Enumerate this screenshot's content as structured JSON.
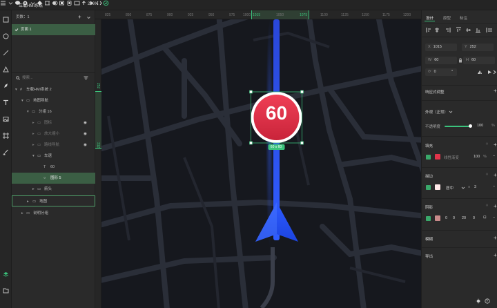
{
  "topbar": {
    "app_name": "车载HMI系统",
    "zoom": "246%"
  },
  "layers": {
    "pages_label": "页数：1",
    "page_item": "页面 1",
    "search_placeholder": "搜索...",
    "tree": [
      {
        "label": "车载HMI系统 2"
      },
      {
        "label": "地图导航"
      },
      {
        "label": "分组 16"
      },
      {
        "label": "图标"
      },
      {
        "label": "放大缩小"
      },
      {
        "label": "路线导航"
      },
      {
        "label": "车速"
      },
      {
        "label": "60"
      },
      {
        "label": "图形 5"
      },
      {
        "label": "箭头"
      },
      {
        "label": "地图"
      },
      {
        "label": "说明分组"
      }
    ]
  },
  "ruler": {
    "ticks": [
      "825",
      "850",
      "875",
      "900",
      "925",
      "950",
      "975",
      "1000",
      "1025",
      "1050",
      "1075",
      "1100",
      "1125",
      "1150",
      "1175",
      "1200"
    ],
    "highlight_start": "1015",
    "highlight_end": "1075",
    "v_start": "252",
    "v_end": "312"
  },
  "canvas": {
    "speed": "60",
    "selection_size": "60 x 60"
  },
  "rpanel": {
    "tabs": [
      "设计",
      "原型",
      "标注"
    ],
    "x_label": "X",
    "x_value": "1015",
    "y_label": "Y",
    "y_value": "252",
    "w_label": "W",
    "w_value": "60",
    "h_label": "H",
    "h_value": "60",
    "rotation": "0",
    "rotation_unit": "°",
    "responsive": "响应式调整",
    "appearance": "外观（正常）",
    "opacity_label": "不透明度",
    "opacity_value": "100",
    "opacity_unit": "%",
    "fill_title": "填充",
    "fill_color": "#e0344a",
    "fill_name": "线性渐变",
    "fill_opacity": "100",
    "fill_unit": "%",
    "stroke_title": "描边",
    "stroke_color": "#ffe8e8",
    "stroke_position": "居中",
    "stroke_width": "3",
    "shadow_title": "阴影",
    "shadow_color": "#c98a8a",
    "shadow_values": [
      "0",
      "0",
      "20",
      "0"
    ],
    "blur_title": "模糊",
    "export_title": "导出"
  }
}
